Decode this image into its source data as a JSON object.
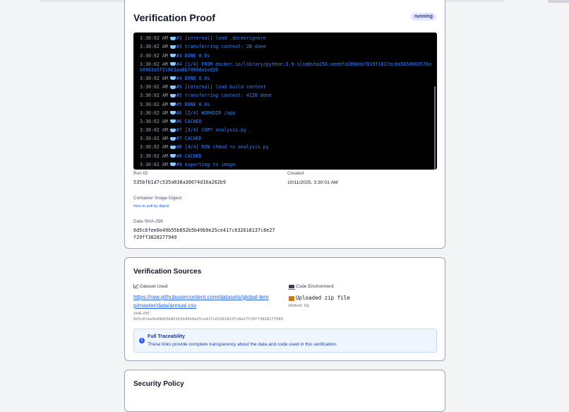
{
  "proof": {
    "title": "Verification Proof",
    "status": "running",
    "logs": [
      {
        "ts": "3:30:02 AM",
        "msg": "#3 [internal] load .dockerignore"
      },
      {
        "ts": "3:30:02 AM",
        "msg": "#3 transferring context: 2B done"
      },
      {
        "ts": "3:30:02 AM",
        "msg": "#3 DONE 0.0s"
      },
      {
        "ts": "3:30:02 AM",
        "msg": "#4 [1/4] FROM docker.io/library/python:3.9-slim@sha256:aeebfa2890da7819f1617ec0a5650669570ab0802e5f51063aa8b7499da1ed26"
      },
      {
        "ts": "3:30:02 AM",
        "msg": "#4 DONE 0.0s"
      },
      {
        "ts": "3:30:02 AM",
        "msg": "#5 [internal] load build context"
      },
      {
        "ts": "3:30:02 AM",
        "msg": "#5 transferring context: 412B done"
      },
      {
        "ts": "3:30:02 AM",
        "msg": "#5 DONE 0.0s"
      },
      {
        "ts": "3:30:02 AM",
        "msg": "#6 [2/4] WORKDIR /app"
      },
      {
        "ts": "3:30:02 AM",
        "msg": "#6 CACHED"
      },
      {
        "ts": "3:30:02 AM",
        "msg": "#7 [3/4] COPY analysis.py ."
      },
      {
        "ts": "3:30:02 AM",
        "msg": "#7 CACHED"
      },
      {
        "ts": "3:30:02 AM",
        "msg": "#8 [4/4] RUN chmod +x analysis.py"
      },
      {
        "ts": "3:30:02 AM",
        "msg": "#8 CACHED"
      },
      {
        "ts": "3:30:02 AM",
        "msg": "#9 exporting to image"
      }
    ],
    "run_id_label": "Run ID",
    "run_id": "535bfb1d7c535a038a38674d16a262b9",
    "created_label": "Created",
    "created": "10/11/2025, 3:30:01 AM",
    "digest_label": "Container Image Digest",
    "digest_link": "How to pull by digest",
    "sha_label": "Data SHA-256",
    "sha_line1": "6d5c6fee0e49b55b852b5b49b9e25ce417c632618137c8e27",
    "sha_line2": "f29ff3828277949"
  },
  "sources": {
    "title": "Verification Sources",
    "dataset_label": "Dataset Used",
    "dataset_url_line1": "https://raw.githubusercontent.com/datasets/global-tem",
    "dataset_url_line2": "p/master/data/annual.csv",
    "dataset_sha_label": "SHA-256:",
    "dataset_sha": "6d5c6fee0e49b55b852b5b49b9e25ce417c632618137c8e27f29ff3828277949",
    "code_label": "Code Environment",
    "code_value": "Uploaded zip file",
    "code_method": "Method: Zip",
    "info_title": "Full Traceability",
    "info_text": "These links provide complete transparency about the data and code used in this verification."
  },
  "security": {
    "title": "Security Policy"
  }
}
